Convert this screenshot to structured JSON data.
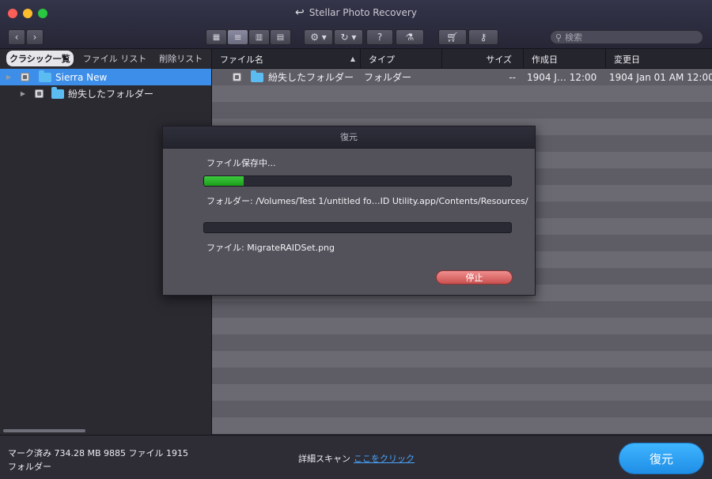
{
  "window": {
    "title": "Stellar Photo Recovery"
  },
  "toolbar": {
    "search_placeholder": "検索",
    "icons": [
      "back-icon",
      "forward-icon",
      "grid-view-icon",
      "list-view-icon",
      "column-view-icon",
      "coverflow-view-icon",
      "gear-icon",
      "history-icon",
      "help-icon",
      "scan-icon",
      "cart-icon",
      "key-icon",
      "search-icon"
    ]
  },
  "sidebar": {
    "tabs": [
      {
        "label": "クラシック一覧",
        "active": true
      },
      {
        "label": "ファイル リスト",
        "active": false
      },
      {
        "label": "削除リスト",
        "active": false
      }
    ],
    "tree": [
      {
        "label": "Sierra New",
        "selected": true
      },
      {
        "label": "紛失したフォルダー",
        "selected": false
      }
    ]
  },
  "table": {
    "columns": [
      "ファイル名",
      "タイプ",
      "サイズ",
      "作成日",
      "変更日"
    ],
    "rows": [
      {
        "name": "紛失したフォルダー",
        "type": "フォルダー",
        "size": "--",
        "created": "1904 J… 12:00",
        "modified": "1904 Jan 01 AM 12:00"
      }
    ]
  },
  "dialog": {
    "title": "復元",
    "status": "ファイル保存中...",
    "progress_percent": 13,
    "folder_line": "フォルダー: /Volumes/Test 1/untitled fo…ID Utility.app/Contents/Resources/",
    "file_progress_percent": 0,
    "file_line": "ファイル: MigrateRAIDSet.png",
    "stop_label": "停止"
  },
  "footer": {
    "stats_line1": "マーク済み 734.28 MB  9885 ファイル  1915",
    "stats_line2": "フォルダー",
    "detail_label": "詳細スキャン",
    "detail_link": "ここをクリック",
    "restore_label": "復元"
  },
  "colors": {
    "accent_blue": "#3d8ee8",
    "progress_green": "#2bb52b",
    "stop_red": "#d96060",
    "restore_blue": "#2a9ff2"
  }
}
